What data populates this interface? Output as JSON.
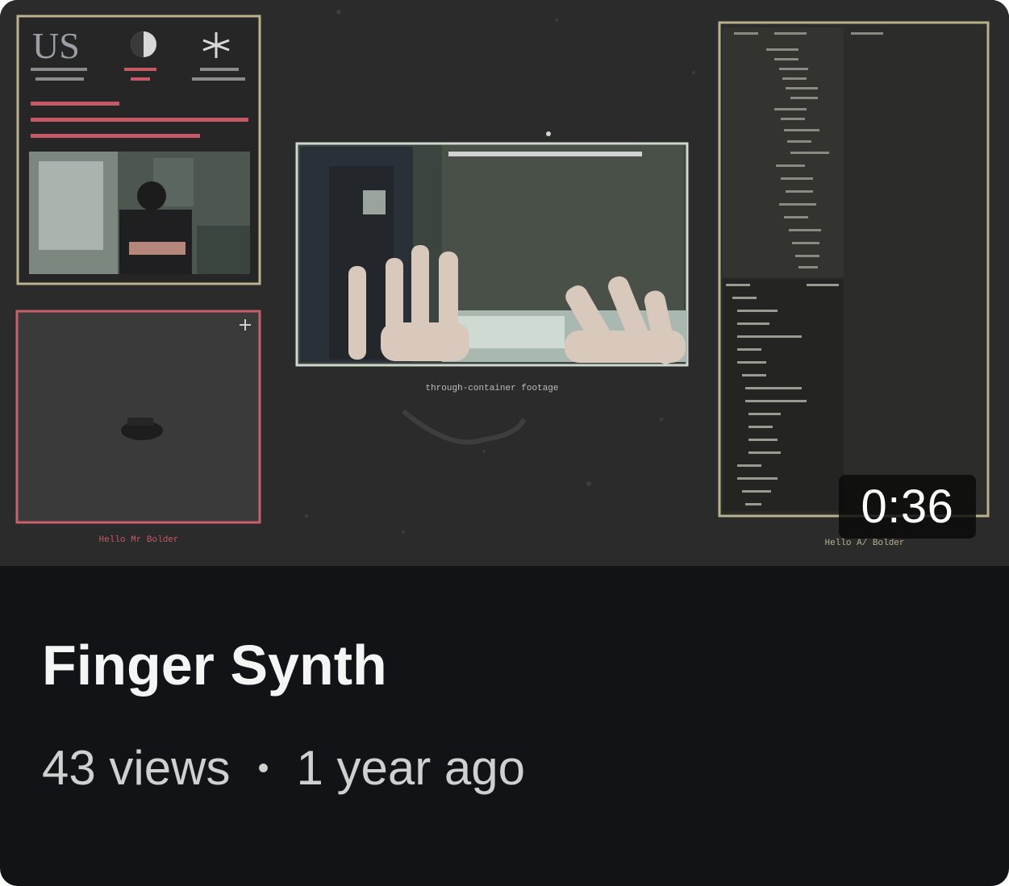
{
  "video": {
    "title": "Finger Synth",
    "duration": "0:36",
    "views": "43 views",
    "separator": "•",
    "age": "1 year ago"
  },
  "thumbnail": {
    "logo_text": "US",
    "caption_center": "through-container footage",
    "caption_left": "Hello Mr Bolder",
    "caption_right": "Hello A/ Bolder",
    "colors": {
      "frame_tan": "#b9b28c",
      "frame_red": "#c8606a",
      "background": "#2b2b2b"
    }
  }
}
